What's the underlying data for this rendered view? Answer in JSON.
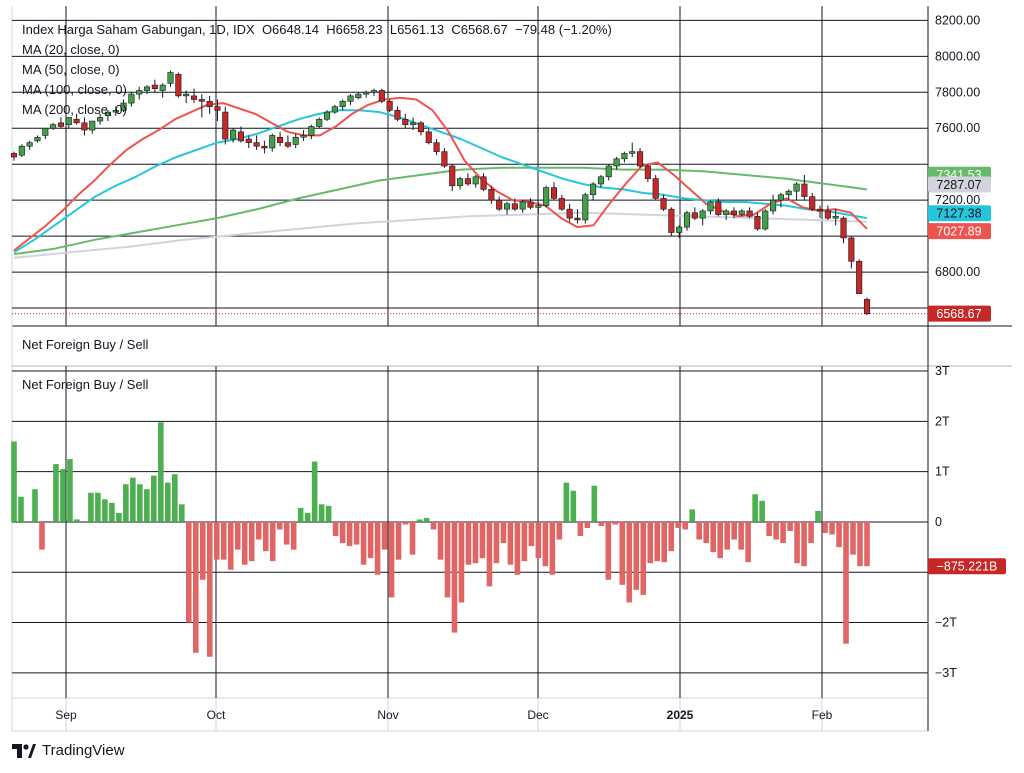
{
  "legend": {
    "title": "Index Harga Saham Gabungan, 1D, IDX",
    "open": "O6648.14",
    "high": "H6658.23",
    "low": "L6561.13",
    "close": "C6568.67",
    "change": "−79.48 (−1.20%)",
    "ma_lines": [
      "MA (20, close, 0)",
      "MA (50, close, 0)",
      "MA (100, close, 0)",
      "MA (200, close, 0)"
    ]
  },
  "pane2_title": "Net Foreign Buy / Sell",
  "pane3_title": "Net Foreign Buy / Sell",
  "brand": "TradingView",
  "colors": {
    "up": "#43a047",
    "down": "#c62828",
    "ma20": "#ef5350",
    "ma50": "#26c6da",
    "ma100": "#66bb6a",
    "ma200": "#d1d4dc",
    "bar_up": "#4caf50",
    "bar_down": "#e06666"
  },
  "chart_data": [
    {
      "type": "candlestick",
      "y_ticks": [
        "8200.00",
        "8000.00",
        "7800.00",
        "7600.00",
        "7200.00",
        "6800.00"
      ],
      "ylim": [
        6500,
        8280
      ],
      "x_labels": [
        "Sep",
        "Oct",
        "Nov",
        "Dec",
        "2025",
        "Feb"
      ],
      "candles": [
        [
          7460,
          7470,
          7420,
          7440
        ],
        [
          7450,
          7510,
          7440,
          7500
        ],
        [
          7500,
          7530,
          7480,
          7520
        ],
        [
          7530,
          7560,
          7520,
          7550
        ],
        [
          7560,
          7600,
          7540,
          7600
        ],
        [
          7600,
          7630,
          7590,
          7620
        ],
        [
          7630,
          7660,
          7600,
          7610
        ],
        [
          7620,
          7660,
          7600,
          7660
        ],
        [
          7650,
          7680,
          7620,
          7630
        ],
        [
          7630,
          7660,
          7560,
          7590
        ],
        [
          7590,
          7640,
          7570,
          7640
        ],
        [
          7640,
          7680,
          7620,
          7660
        ],
        [
          7670,
          7700,
          7640,
          7690
        ],
        [
          7690,
          7720,
          7670,
          7700
        ],
        [
          7700,
          7760,
          7690,
          7740
        ],
        [
          7740,
          7800,
          7720,
          7790
        ],
        [
          7790,
          7830,
          7760,
          7810
        ],
        [
          7810,
          7840,
          7790,
          7830
        ],
        [
          7840,
          7870,
          7800,
          7820
        ],
        [
          7810,
          7850,
          7770,
          7840
        ],
        [
          7850,
          7920,
          7830,
          7910
        ],
        [
          7900,
          7910,
          7770,
          7780
        ],
        [
          7780,
          7810,
          7740,
          7790
        ],
        [
          7780,
          7820,
          7740,
          7760
        ],
        [
          7760,
          7790,
          7660,
          7750
        ],
        [
          7750,
          7780,
          7680,
          7720
        ],
        [
          7720,
          7760,
          7640,
          7700
        ],
        [
          7690,
          7720,
          7510,
          7540
        ],
        [
          7540,
          7600,
          7520,
          7590
        ],
        [
          7580,
          7610,
          7520,
          7530
        ],
        [
          7540,
          7560,
          7490,
          7520
        ],
        [
          7520,
          7560,
          7480,
          7500
        ],
        [
          7500,
          7530,
          7460,
          7490
        ],
        [
          7490,
          7570,
          7470,
          7560
        ],
        [
          7550,
          7580,
          7500,
          7520
        ],
        [
          7520,
          7560,
          7490,
          7500
        ],
        [
          7510,
          7570,
          7490,
          7550
        ],
        [
          7550,
          7590,
          7530,
          7560
        ],
        [
          7560,
          7620,
          7540,
          7610
        ],
        [
          7610,
          7660,
          7600,
          7650
        ],
        [
          7650,
          7700,
          7640,
          7690
        ],
        [
          7690,
          7730,
          7680,
          7720
        ],
        [
          7720,
          7760,
          7700,
          7750
        ],
        [
          7750,
          7790,
          7730,
          7780
        ],
        [
          7770,
          7800,
          7760,
          7790
        ],
        [
          7790,
          7810,
          7770,
          7800
        ],
        [
          7800,
          7820,
          7780,
          7810
        ],
        [
          7810,
          7820,
          7740,
          7750
        ],
        [
          7750,
          7760,
          7690,
          7700
        ],
        [
          7700,
          7720,
          7640,
          7650
        ],
        [
          7650,
          7680,
          7600,
          7620
        ],
        [
          7620,
          7660,
          7590,
          7630
        ],
        [
          7630,
          7640,
          7560,
          7580
        ],
        [
          7580,
          7600,
          7510,
          7520
        ],
        [
          7520,
          7540,
          7450,
          7470
        ],
        [
          7470,
          7490,
          7380,
          7390
        ],
        [
          7390,
          7400,
          7250,
          7280
        ],
        [
          7280,
          7330,
          7260,
          7320
        ],
        [
          7320,
          7350,
          7280,
          7290
        ],
        [
          7290,
          7340,
          7270,
          7330
        ],
        [
          7330,
          7350,
          7250,
          7260
        ],
        [
          7260,
          7280,
          7180,
          7200
        ],
        [
          7200,
          7220,
          7140,
          7150
        ],
        [
          7150,
          7190,
          7120,
          7180
        ],
        [
          7180,
          7210,
          7140,
          7150
        ],
        [
          7150,
          7200,
          7130,
          7190
        ],
        [
          7190,
          7210,
          7150,
          7160
        ],
        [
          7160,
          7190,
          7120,
          7170
        ],
        [
          7170,
          7280,
          7160,
          7270
        ],
        [
          7270,
          7300,
          7200,
          7210
        ],
        [
          7210,
          7230,
          7140,
          7150
        ],
        [
          7150,
          7180,
          7080,
          7100
        ],
        [
          7100,
          7150,
          7070,
          7090
        ],
        [
          7090,
          7240,
          7070,
          7230
        ],
        [
          7230,
          7300,
          7200,
          7290
        ],
        [
          7290,
          7340,
          7270,
          7330
        ],
        [
          7330,
          7400,
          7310,
          7390
        ],
        [
          7390,
          7440,
          7370,
          7430
        ],
        [
          7430,
          7470,
          7410,
          7460
        ],
        [
          7460,
          7520,
          7440,
          7470
        ],
        [
          7470,
          7490,
          7380,
          7390
        ],
        [
          7390,
          7400,
          7300,
          7320
        ],
        [
          7320,
          7340,
          7200,
          7210
        ],
        [
          7210,
          7230,
          7140,
          7150
        ],
        [
          7150,
          7160,
          7000,
          7020
        ],
        [
          7020,
          7060,
          6990,
          7050
        ],
        [
          7050,
          7140,
          7030,
          7130
        ],
        [
          7130,
          7160,
          7090,
          7100
        ],
        [
          7100,
          7150,
          7060,
          7140
        ],
        [
          7140,
          7200,
          7120,
          7190
        ],
        [
          7190,
          7210,
          7110,
          7120
        ],
        [
          7120,
          7150,
          7090,
          7140
        ],
        [
          7140,
          7160,
          7100,
          7120
        ],
        [
          7120,
          7150,
          7110,
          7140
        ],
        [
          7140,
          7160,
          7100,
          7110
        ],
        [
          7110,
          7130,
          7030,
          7040
        ],
        [
          7040,
          7150,
          7030,
          7140
        ],
        [
          7140,
          7230,
          7120,
          7200
        ],
        [
          7200,
          7240,
          7160,
          7230
        ],
        [
          7230,
          7260,
          7200,
          7250
        ],
        [
          7250,
          7300,
          7200,
          7290
        ],
        [
          7290,
          7340,
          7200,
          7220
        ],
        [
          7220,
          7240,
          7140,
          7150
        ],
        [
          7150,
          7170,
          7100,
          7140
        ],
        [
          7140,
          7170,
          7090,
          7100
        ],
        [
          7100,
          7150,
          7060,
          7110
        ],
        [
          7100,
          7110,
          6960,
          6990
        ],
        [
          6990,
          7000,
          6820,
          6860
        ],
        [
          6860,
          6870,
          6680,
          6680
        ],
        [
          6648,
          6658,
          6561,
          6568
        ]
      ],
      "ma20": [
        6920,
        6990,
        7060,
        7140,
        7230,
        7310,
        7400,
        7480,
        7540,
        7590,
        7650,
        7690,
        7730,
        7740,
        7710,
        7680,
        7630,
        7580,
        7560,
        7560,
        7610,
        7680,
        7730,
        7760,
        7770,
        7760,
        7700,
        7580,
        7420,
        7320,
        7250,
        7200,
        7190,
        7170,
        7100,
        7050,
        7060,
        7180,
        7290,
        7390,
        7410,
        7340,
        7260,
        7180,
        7140,
        7110,
        7120,
        7180,
        7210,
        7160,
        7140,
        7150,
        7130,
        7040
      ],
      "ma50": [
        6910,
        6980,
        7060,
        7140,
        7220,
        7280,
        7330,
        7390,
        7440,
        7480,
        7520,
        7540,
        7570,
        7610,
        7650,
        7680,
        7700,
        7700,
        7690,
        7660,
        7620,
        7580,
        7540,
        7490,
        7440,
        7400,
        7360,
        7320,
        7290,
        7270,
        7260,
        7240,
        7230,
        7210,
        7200,
        7190,
        7190,
        7180,
        7170,
        7150,
        7140,
        7120,
        7100
      ],
      "ma100": [
        6900,
        6930,
        6980,
        7020,
        7060,
        7100,
        7150,
        7210,
        7260,
        7310,
        7340,
        7370,
        7380,
        7380,
        7380,
        7370,
        7370,
        7360,
        7340,
        7320,
        7290,
        7260
      ],
      "ma200": [
        6880,
        6910,
        6940,
        6980,
        7010,
        7040,
        7070,
        7090,
        7110,
        7120,
        7130,
        7120,
        7110,
        7100,
        7090,
        7080
      ],
      "price_labels": [
        "7341.53",
        "7287.07",
        "7127.38",
        "7027.89",
        "6568.67"
      ]
    },
    {
      "type": "bar",
      "title": "Net Foreign Buy / Sell",
      "y_ticks": [
        "3T",
        "2T",
        "1T",
        "0",
        "−2T",
        "−3T"
      ],
      "ylim": [
        -3.5,
        3.1
      ],
      "values": [
        1.6,
        0.5,
        0,
        0.65,
        -0.55,
        0,
        1.15,
        1.05,
        1.25,
        0.05,
        0,
        0.58,
        0.58,
        0.45,
        0.38,
        0.18,
        0.75,
        0.88,
        0.75,
        0.65,
        0.92,
        1.98,
        0.78,
        0.95,
        0.35,
        -2.0,
        -2.6,
        -1.15,
        -2.68,
        -0.75,
        -0.75,
        -0.95,
        -0.55,
        -0.85,
        -0.78,
        -0.35,
        -0.58,
        -0.78,
        -0.15,
        -0.45,
        -0.55,
        0.28,
        0.18,
        1.2,
        0.35,
        0.32,
        -0.28,
        -0.42,
        -0.48,
        -0.45,
        -0.85,
        -0.72,
        -1.05,
        -0.55,
        -1.5,
        -0.75,
        -0.05,
        -0.65,
        0.05,
        0.08,
        -0.15,
        -0.75,
        -1.5,
        -2.2,
        -1.6,
        -0.85,
        -0.82,
        -0.72,
        -1.28,
        -0.82,
        -0.42,
        -0.85,
        -1.05,
        -0.78,
        -0.48,
        -0.72,
        -0.88,
        -1.05,
        -0.35,
        0.78,
        0.62,
        -0.28,
        -0.12,
        0.72,
        -0.08,
        -1.15,
        -0.05,
        -1.25,
        -1.6,
        -1.35,
        -1.45,
        -0.82,
        -0.78,
        -0.8,
        -0.58,
        -0.12,
        -0.15,
        0.25,
        -0.35,
        -0.42,
        -0.6,
        -0.72,
        -0.55,
        -0.35,
        -0.55,
        -0.8,
        0.55,
        0.42,
        -0.28,
        -0.35,
        -0.42,
        -0.18,
        -0.82,
        -0.88,
        -0.42,
        0.22,
        -0.22,
        -0.25,
        -0.5,
        -2.42,
        -0.65,
        -0.88,
        -0.88
      ],
      "last_value_label": "−875.221B"
    }
  ]
}
